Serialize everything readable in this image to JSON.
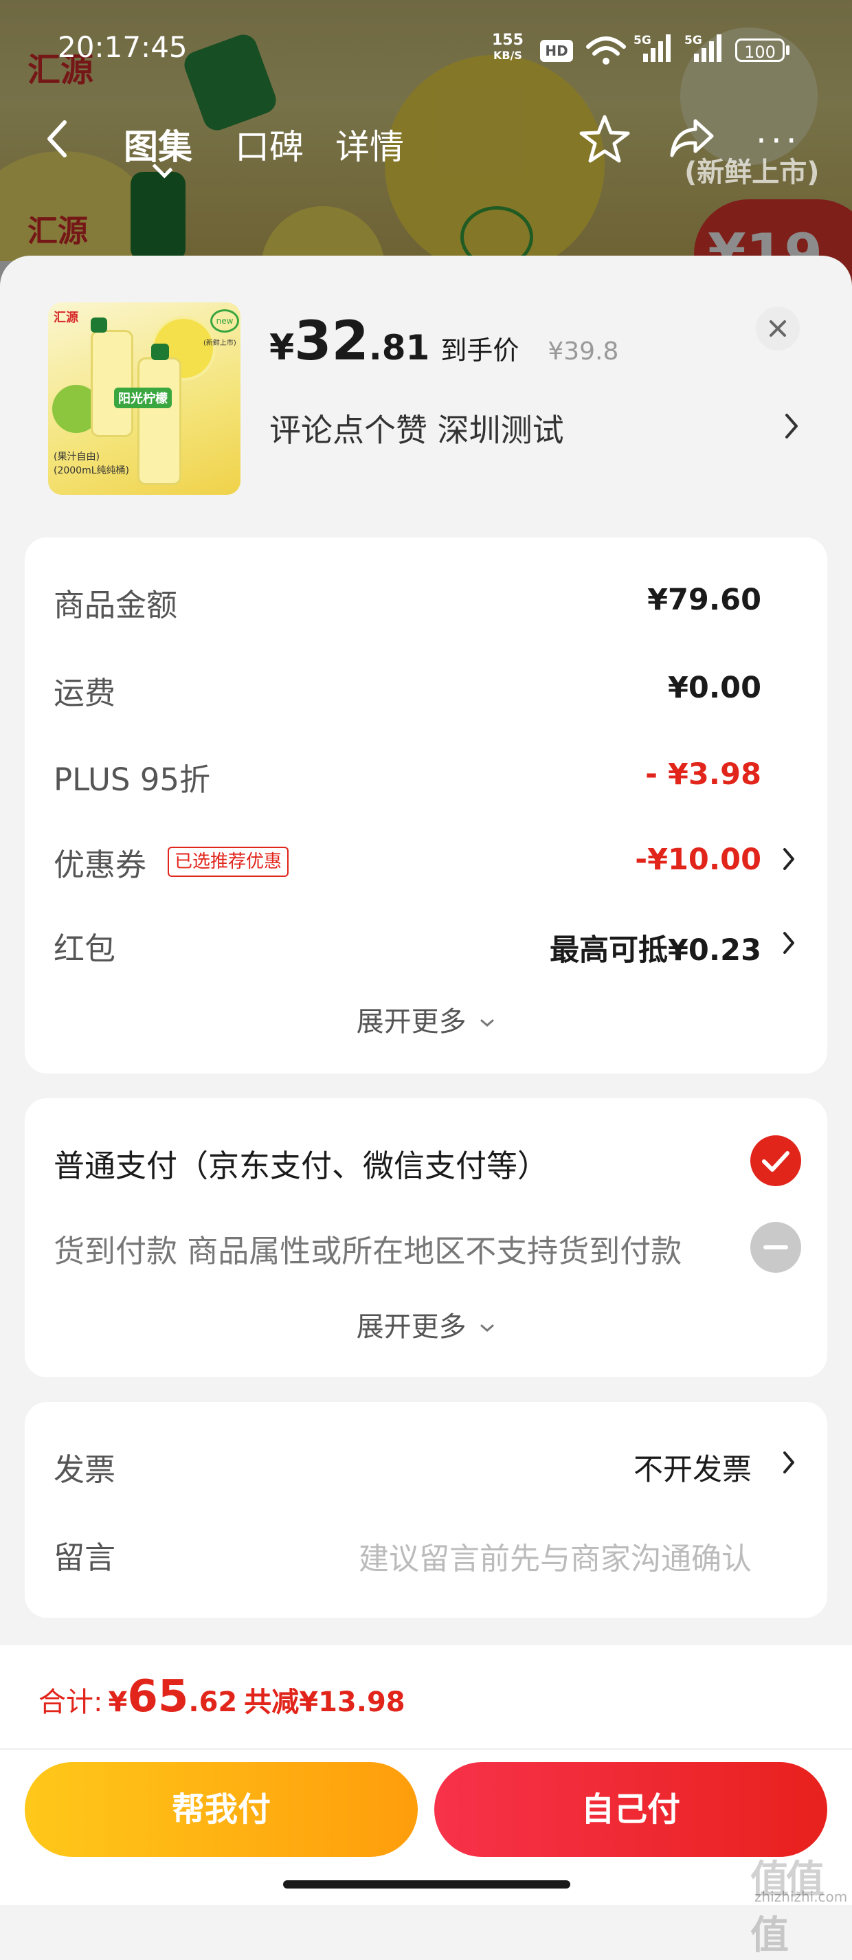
{
  "status_bar": {
    "time": "20:17:45",
    "net_speed_value": "155",
    "net_speed_unit": "KB/S",
    "hd_badge": "HD",
    "battery": "100"
  },
  "nav": {
    "tabs": [
      {
        "label": "图集"
      },
      {
        "label": "口碑"
      },
      {
        "label": "详情"
      }
    ],
    "new_tag": "(新鲜上市)",
    "brand_text": "汇源"
  },
  "product": {
    "price_symbol": "¥",
    "price_integer": "32",
    "price_decimal": ".81",
    "price_label": "到手价",
    "original_price": "¥39.8",
    "description": "评论点个赞 深圳测试",
    "thumb_texts": {
      "brand": "汇源",
      "new": "new",
      "new_sub": "(新鲜上市)",
      "product_name": "阳光柠檬",
      "spec_1": "(果汁自由)",
      "spec_2": "(2000mL纯纯桶)"
    }
  },
  "summary": {
    "rows": [
      {
        "label": "商品金额",
        "value": "¥79.60"
      },
      {
        "label": "运费",
        "value": "¥0.00"
      },
      {
        "label": "PLUS 95折",
        "value": "- ¥3.98"
      },
      {
        "label": "优惠券",
        "tag": "已选推荐优惠",
        "value": "-¥10.00"
      },
      {
        "label": "红包",
        "value": "最高可抵¥0.23"
      }
    ],
    "expand_label": "展开更多"
  },
  "payment": {
    "options": [
      {
        "label": "普通支付（京东支付、微信支付等）",
        "selected": true
      },
      {
        "label": "货到付款 商品属性或所在地区不支持货到付款",
        "selected": false,
        "disabled": true
      }
    ],
    "expand_label": "展开更多"
  },
  "extra": {
    "invoice_label": "发票",
    "invoice_value": "不开发票",
    "message_label": "留言",
    "message_placeholder": "建议留言前先与商家沟通确认"
  },
  "footer": {
    "total_label": "合计:",
    "total_symbol": "¥",
    "total_integer": "65",
    "total_decimal": ".62",
    "total_saved": "共减¥13.98",
    "help_pay_label": "帮我付",
    "self_pay_label": "自己付"
  },
  "watermark": {
    "text": "值值值",
    "sub": "zhizhizhi.com"
  },
  "colors": {
    "accent_red": "#e1251b",
    "help_pay_gradient_start": "#ffc81a",
    "help_pay_gradient_end": "#ff9d0b",
    "self_pay_gradient_start": "#f7324a",
    "self_pay_gradient_end": "#e8211d"
  }
}
